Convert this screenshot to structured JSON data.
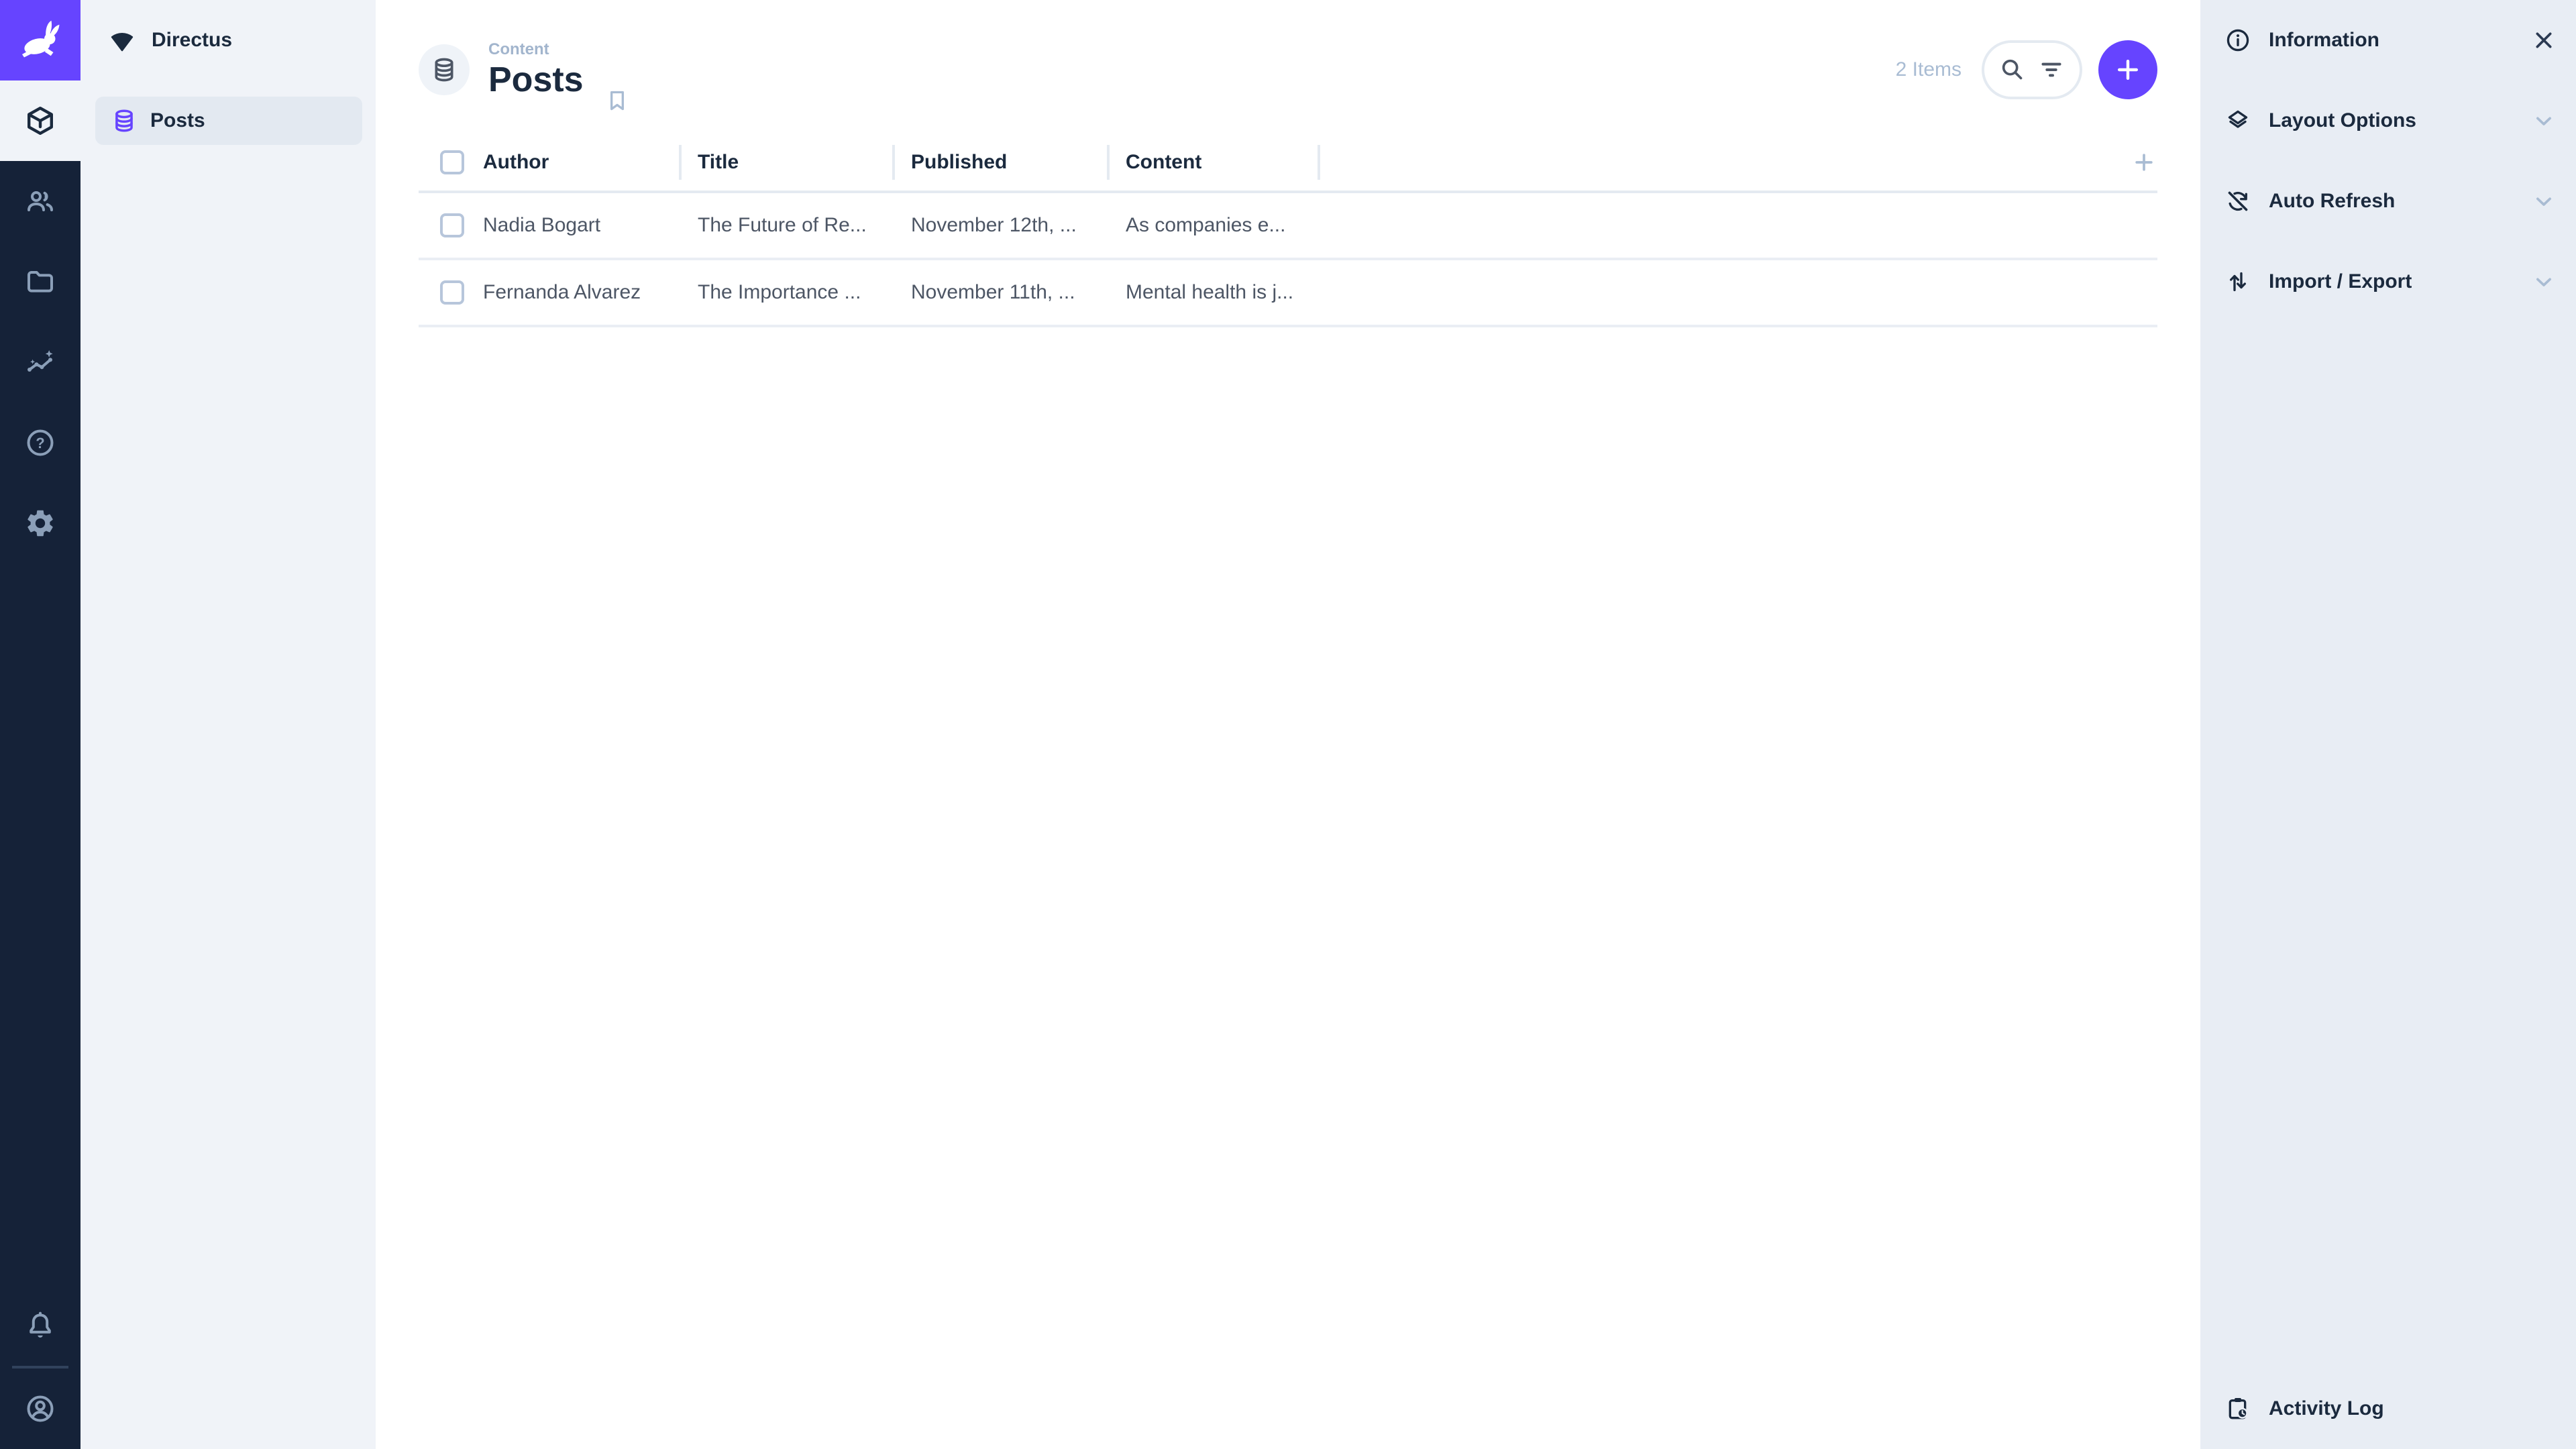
{
  "colors": {
    "accent_purple": "#6644ff",
    "module_bar_background": "#152238",
    "module_icon": "#8b9fb8",
    "dark_navy_text": "#1b2a3e",
    "body_text": "#4d5665",
    "muted_slate": "#a9bcd3",
    "nav_background": "#f0f3f8",
    "nav_active_background": "#e3e9f1",
    "sidebar_background": "#e8edf4",
    "border": "#e4eaf1"
  },
  "module_bar": {
    "logo": "directus-rabbit-logo",
    "modules": [
      {
        "name": "content",
        "icon": "box-icon",
        "active": true
      },
      {
        "name": "users",
        "icon": "users-icon",
        "active": false
      },
      {
        "name": "files",
        "icon": "folder-icon",
        "active": false
      },
      {
        "name": "insights",
        "icon": "insights-icon",
        "active": false
      },
      {
        "name": "help",
        "icon": "help-icon",
        "active": false
      },
      {
        "name": "settings",
        "icon": "gear-icon",
        "active": false
      }
    ],
    "bottom": [
      {
        "name": "notifications",
        "icon": "bell-icon"
      },
      {
        "name": "account",
        "icon": "account-circle-icon"
      }
    ]
  },
  "nav": {
    "project_name": "Directus",
    "items": [
      {
        "label": "Posts",
        "icon": "database-icon",
        "active": true
      }
    ]
  },
  "page": {
    "breadcrumb": "Content",
    "title": "Posts",
    "items_count": "2 Items"
  },
  "table": {
    "columns": [
      "Author",
      "Title",
      "Published",
      "Content"
    ],
    "rows": [
      {
        "author": "Nadia Bogart",
        "title": "The Future of Re...",
        "published": "November 12th, ...",
        "content": "As companies e..."
      },
      {
        "author": "Fernanda Alvarez",
        "title": "The Importance ...",
        "published": "November 11th, ...",
        "content": "Mental health is j..."
      }
    ]
  },
  "sidebar": {
    "sections": [
      {
        "label": "Information"
      },
      {
        "label": "Layout Options"
      },
      {
        "label": "Auto Refresh"
      },
      {
        "label": "Import / Export"
      }
    ],
    "footer_label": "Activity Log"
  }
}
